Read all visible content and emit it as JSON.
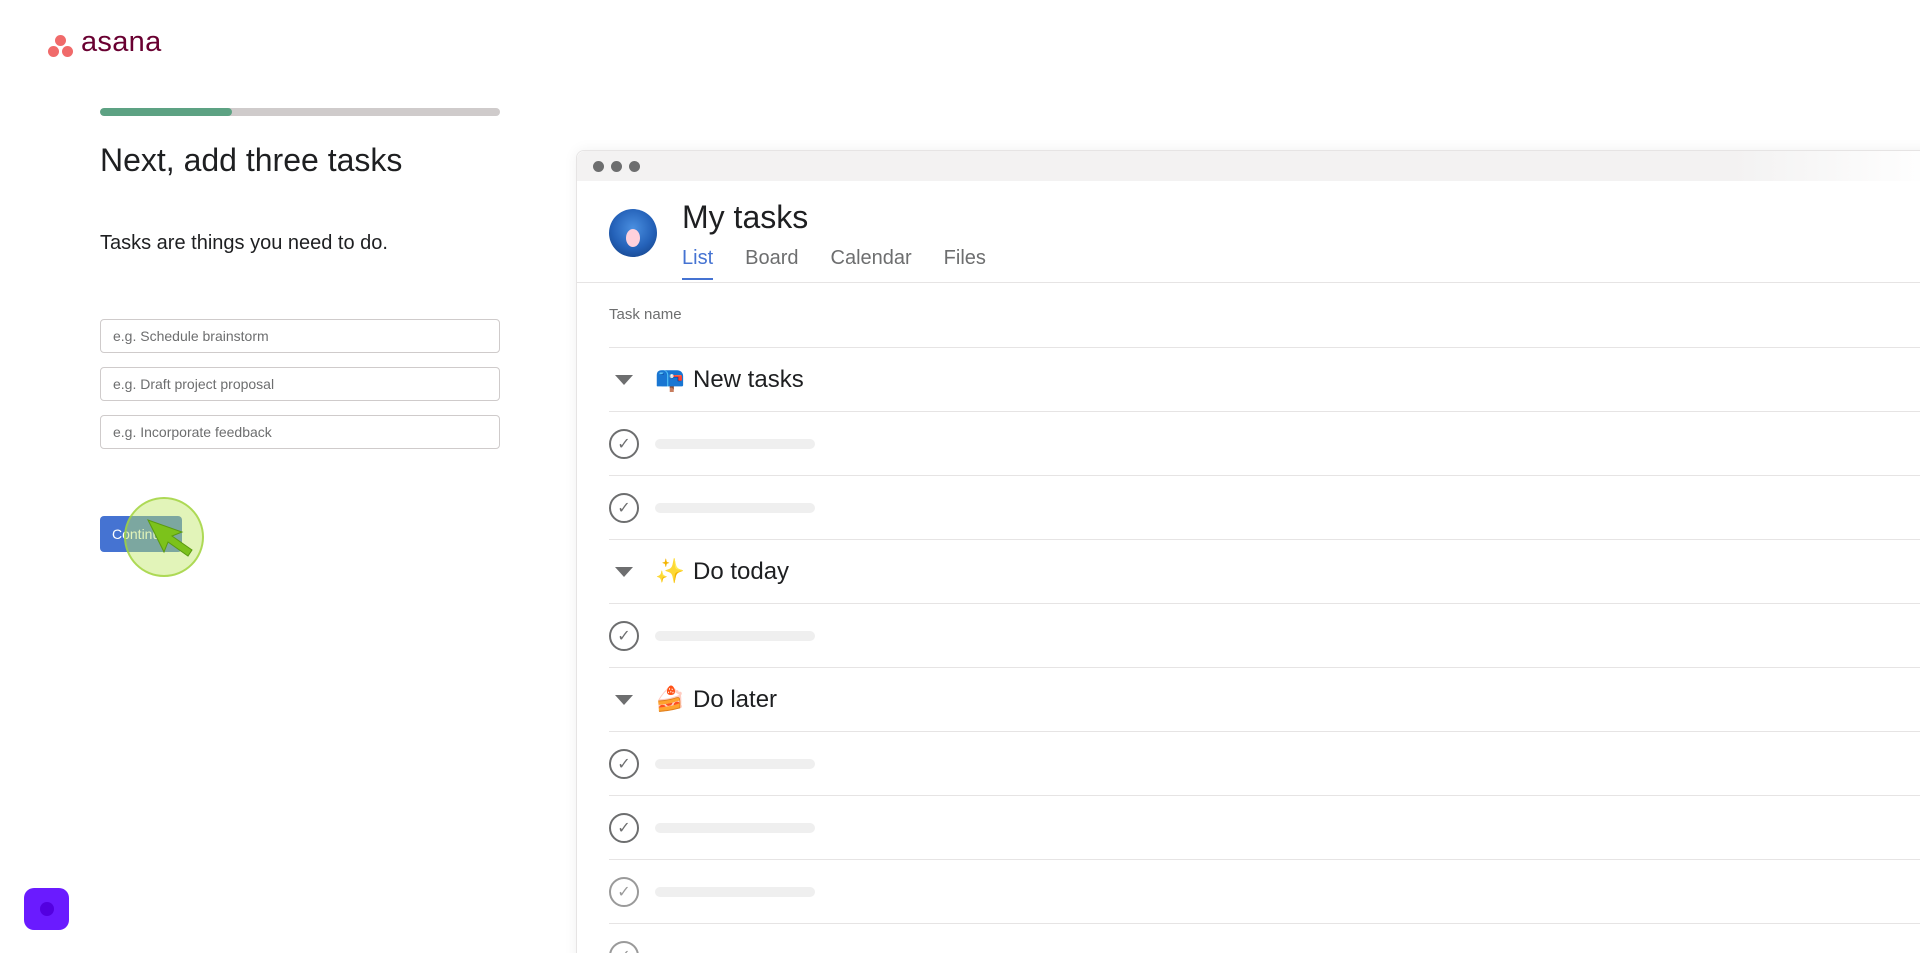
{
  "brand": {
    "name": "asana"
  },
  "onboarding": {
    "progress_fraction": 0.33,
    "heading": "Next, add three tasks",
    "subheading": "Tasks are things you need to do.",
    "inputs": [
      {
        "placeholder": "e.g. Schedule brainstorm",
        "value": ""
      },
      {
        "placeholder": "e.g. Draft project proposal",
        "value": ""
      },
      {
        "placeholder": "e.g. Incorporate feedback",
        "value": ""
      }
    ],
    "continue_label": "Continue"
  },
  "preview": {
    "title": "My tasks",
    "tabs": [
      {
        "label": "List",
        "active": true
      },
      {
        "label": "Board",
        "active": false
      },
      {
        "label": "Calendar",
        "active": false
      },
      {
        "label": "Files",
        "active": false
      }
    ],
    "column_header": "Task name",
    "sections": [
      {
        "emoji": "📪",
        "label": "New tasks",
        "task_count": 2
      },
      {
        "emoji": "✨",
        "label": "Do today",
        "task_count": 1
      },
      {
        "emoji": "🍰",
        "label": "Do later",
        "task_count": 3
      }
    ]
  },
  "colors": {
    "progress": "#5da283",
    "button": "#4573d2",
    "brand_text": "#690031",
    "brand_dots": "#f06a6a",
    "chat_bubble": "#6a1bff"
  }
}
